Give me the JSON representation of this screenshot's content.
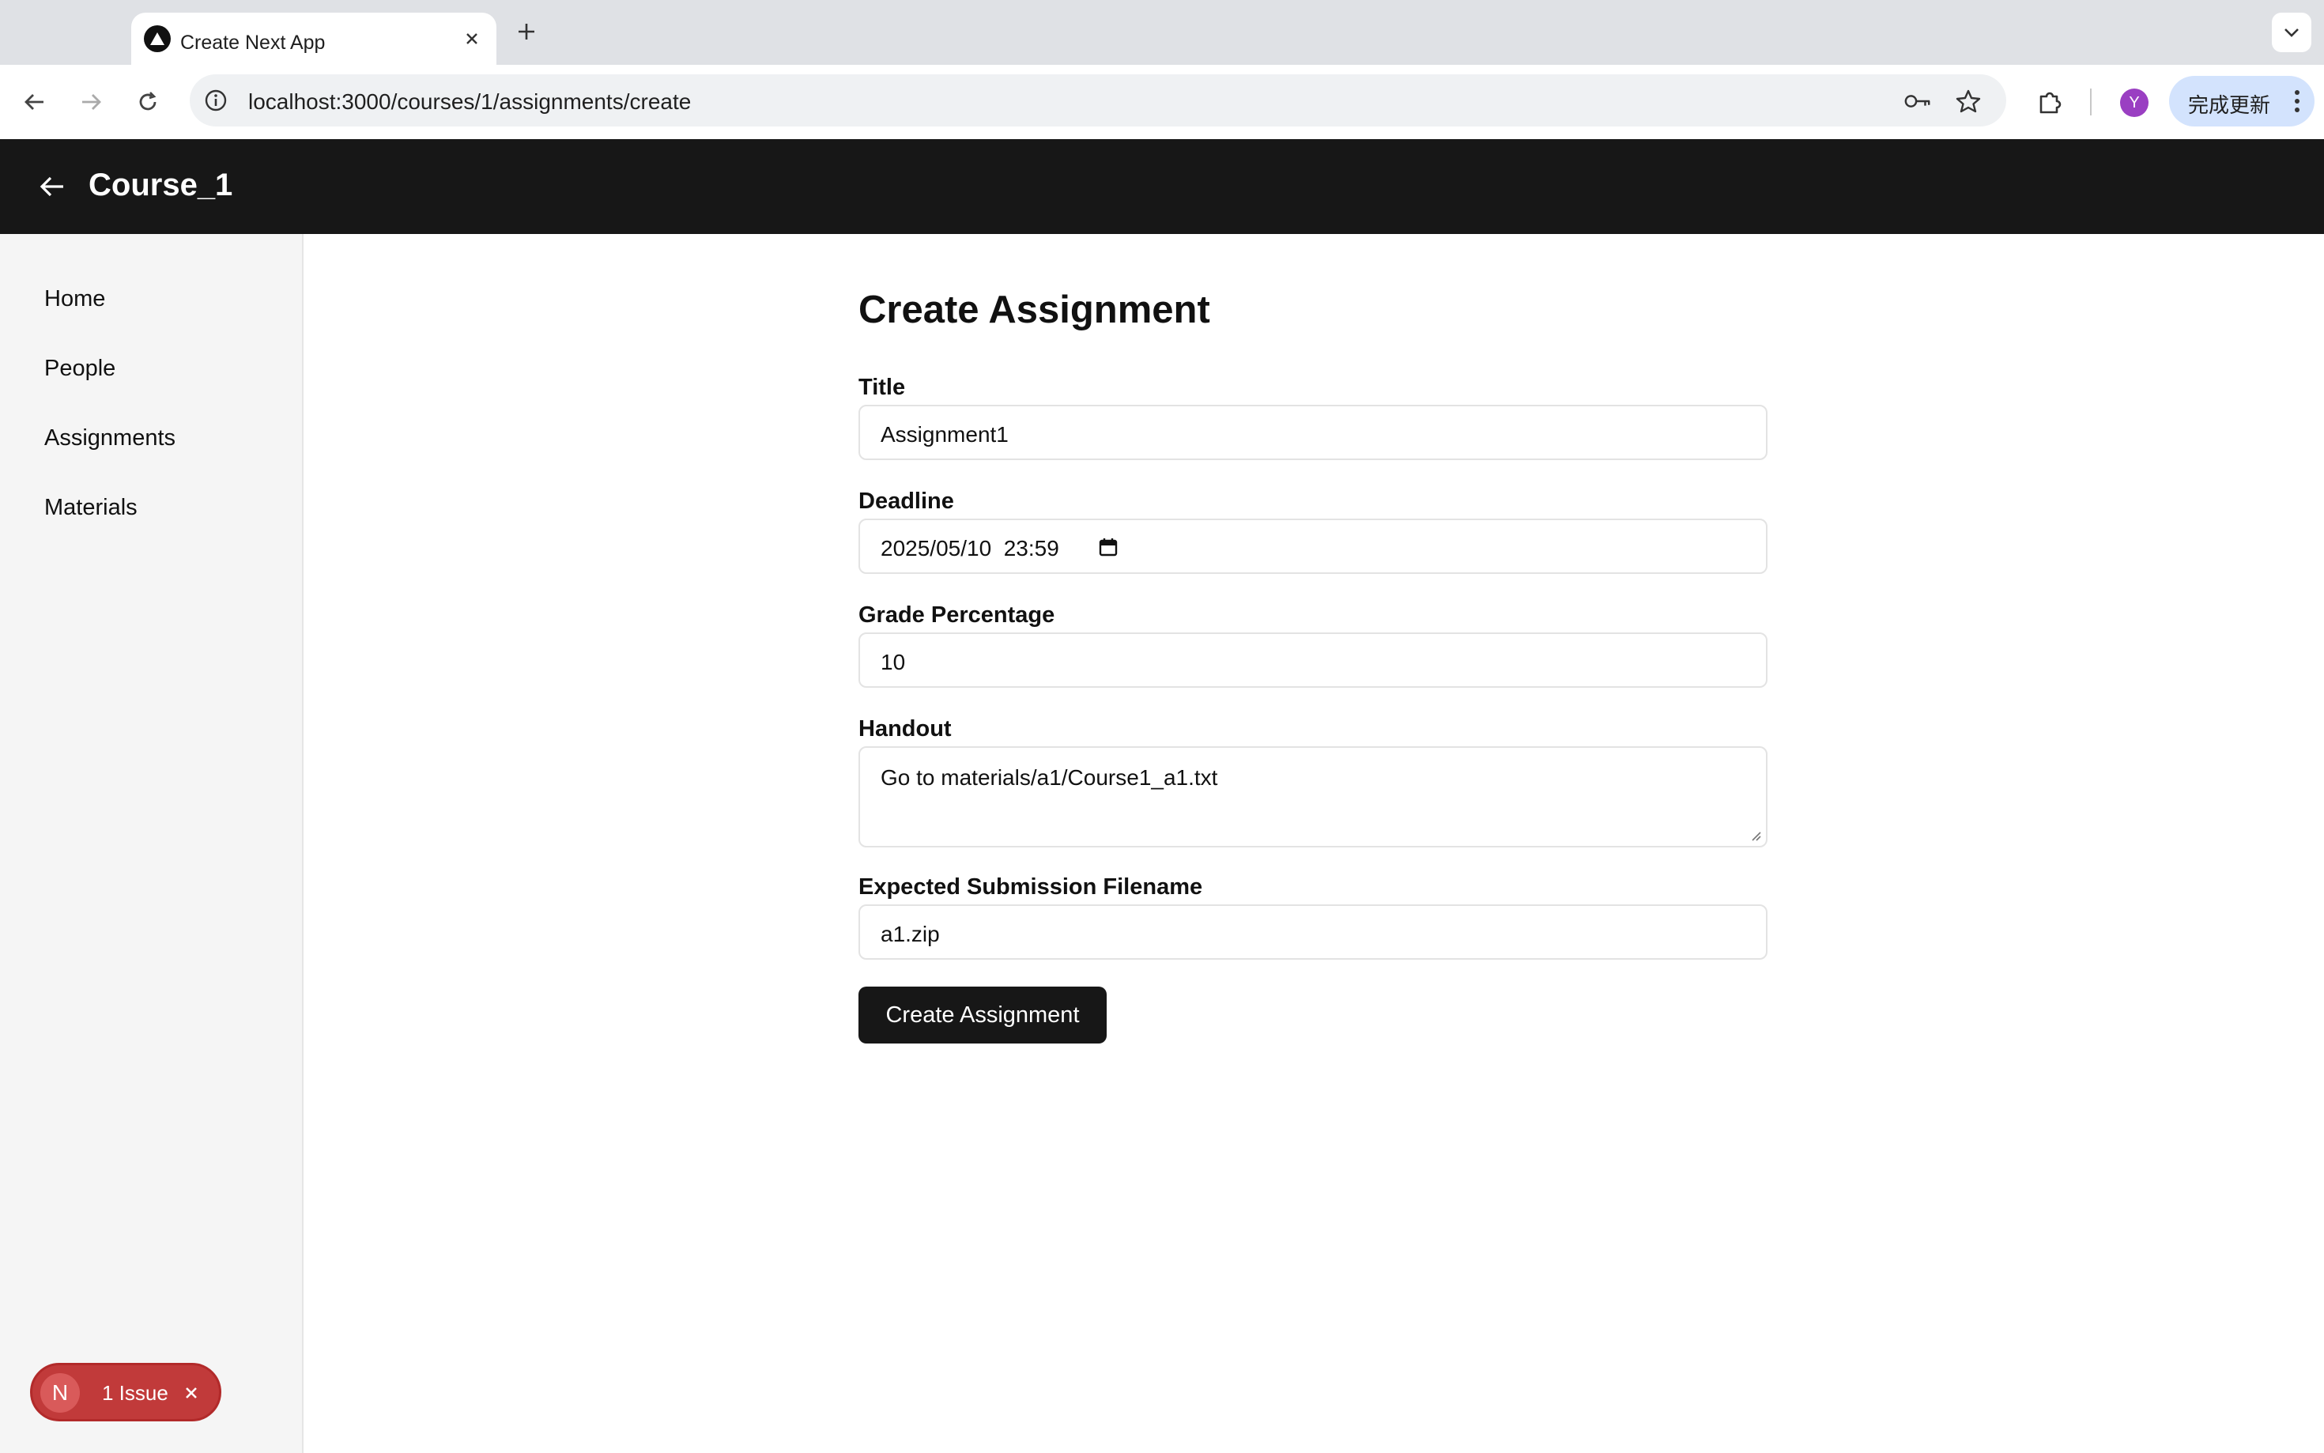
{
  "browser": {
    "tab_title": "Create Next App",
    "url": "localhost:3000/courses/1/assignments/create",
    "avatar_initial": "Y",
    "update_label": "完成更新"
  },
  "header": {
    "course_title": "Course_1"
  },
  "sidebar": {
    "items": [
      {
        "label": "Home"
      },
      {
        "label": "People"
      },
      {
        "label": "Assignments"
      },
      {
        "label": "Materials"
      }
    ]
  },
  "form": {
    "heading": "Create Assignment",
    "title_label": "Title",
    "title_value": "Assignment1",
    "deadline_label": "Deadline",
    "deadline_value": "2025/05/10  23:59",
    "grade_label": "Grade Percentage",
    "grade_value": "10",
    "handout_label": "Handout",
    "handout_value": "Go to materials/a1/Course1_a1.txt",
    "filename_label": "Expected Submission Filename",
    "filename_value": "a1.zip",
    "submit_label": "Create Assignment"
  },
  "issue_badge": {
    "logo": "N",
    "label": "1 Issue"
  },
  "colors": {
    "header_bg": "#171717",
    "button_bg": "#171717",
    "issue_badge": "#c13a3a",
    "avatar": "#9a3fc2",
    "update_button": "#d3e3fd"
  }
}
